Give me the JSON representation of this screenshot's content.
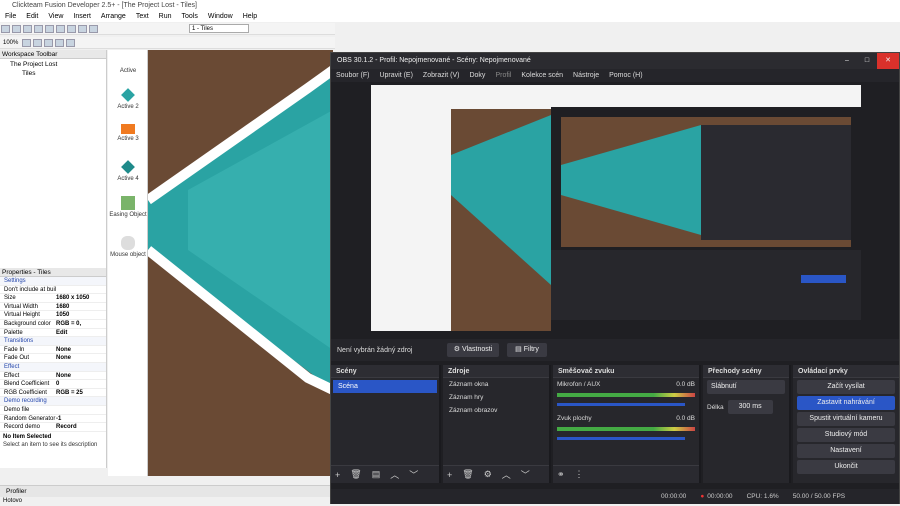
{
  "ct": {
    "title": "Clickteam Fusion Developer 2.5+ - [The Project Lost - Tiles]",
    "menu": [
      "File",
      "Edit",
      "View",
      "Insert",
      "Arrange",
      "Text",
      "Run",
      "Tools",
      "Window",
      "Help"
    ],
    "zoom": "100%",
    "frame_select": "1 - Tiles",
    "workspace": {
      "header": "Workspace Toolbar",
      "project": "The Project Lost",
      "frame": "Tiles"
    },
    "props": {
      "header": "Properties - Tiles",
      "rows": [
        {
          "k": "Settings",
          "v": "",
          "sec": true
        },
        {
          "k": "Don't include at build time",
          "v": ""
        },
        {
          "k": "Size",
          "v": "1680 x 1050"
        },
        {
          "k": "Virtual Width",
          "v": "1680"
        },
        {
          "k": "Virtual Height",
          "v": "1050"
        },
        {
          "k": "Background color",
          "v": "RGB = 0,"
        },
        {
          "k": "Palette",
          "v": "Edit"
        },
        {
          "k": "Transitions",
          "v": "",
          "sec": true
        },
        {
          "k": "Fade In",
          "v": "None"
        },
        {
          "k": "Fade Out",
          "v": "None"
        },
        {
          "k": "Effect",
          "v": "",
          "sec": true
        },
        {
          "k": "Effect",
          "v": "None"
        },
        {
          "k": "Blend Coefficient",
          "v": "0"
        },
        {
          "k": "RGB Coefficient",
          "v": "RGB = 25"
        },
        {
          "k": "Demo recording",
          "v": "",
          "sec": true
        },
        {
          "k": "Demo file",
          "v": ""
        },
        {
          "k": "Random Generator",
          "v": "-1"
        },
        {
          "k": "Record demo",
          "v": "Record"
        }
      ],
      "noitem": "No Item Selected",
      "hint": "Select an item to see its description"
    },
    "objects": [
      {
        "label": "Active"
      },
      {
        "label": "Active 2"
      },
      {
        "label": "Active 3"
      },
      {
        "label": "Active 4"
      },
      {
        "label": "Easing Object"
      },
      {
        "label": "Mouse object"
      }
    ],
    "tab": "Profiler",
    "status": "Hotovo"
  },
  "obs": {
    "title": "OBS 30.1.2 - Profil: Nepojmenované - Scény: Nepojmenované",
    "menu": [
      "Soubor (F)",
      "Upravit (E)",
      "Zobrazit (V)",
      "Doky",
      "Profil",
      "Kolekce scén",
      "Nástroje",
      "Pomoc (H)"
    ],
    "nosource": "Není vybrán žádný zdroj",
    "props_btn": "Vlastnosti",
    "filters_btn": "Filtry",
    "scenes": {
      "title": "Scény",
      "items": [
        "Scéna"
      ]
    },
    "sources": {
      "title": "Zdroje",
      "items": [
        "Záznam okna",
        "Záznam hry",
        "Záznam obrazov"
      ]
    },
    "mixer": {
      "title": "Směšovač zvuku",
      "ch": [
        {
          "name": "Mikrofon / AUX",
          "db": "0.0 dB"
        },
        {
          "name": "Zvuk plochy",
          "db": "0.0 dB"
        }
      ]
    },
    "trans": {
      "title": "Přechody scény",
      "type": "Slábnutí",
      "dur_label": "Délka",
      "dur": "300 ms"
    },
    "controls": {
      "title": "Ovládací prvky",
      "buttons": [
        "Začít vysílat",
        "Zastavit nahrávání",
        "Spustit virtuální kameru",
        "Studiový mód",
        "Nastavení",
        "Ukončit"
      ]
    },
    "status": {
      "t1": "00:00:00",
      "t2": "00:00:00",
      "cpu": "CPU: 1.6%",
      "fps": "50.00 / 50.00 FPS"
    }
  },
  "colors": {
    "accent": "#2a56c6",
    "teal": "#2aa3a3"
  }
}
